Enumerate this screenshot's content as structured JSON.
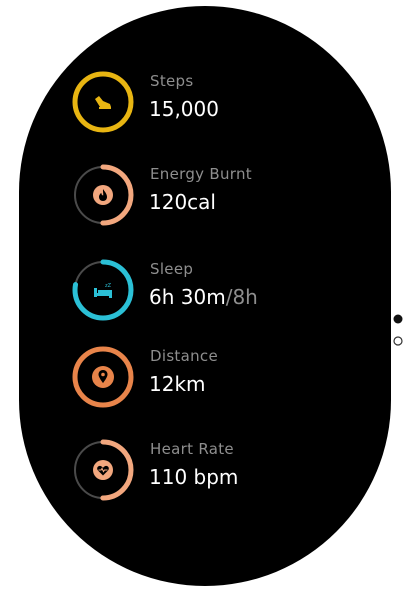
{
  "metrics": [
    {
      "label": "Steps",
      "value": "15,000",
      "goal": "",
      "color": "#E8B512",
      "progress": 1.0,
      "icon": "shoe-icon"
    },
    {
      "label": "Energy Burnt",
      "value": "120cal",
      "goal": "",
      "color": "#F2A77E",
      "progress": 0.5,
      "icon": "flame-icon"
    },
    {
      "label": "Sleep",
      "value": "6h 30m",
      "goal": "/8h",
      "color": "#2BC0D6",
      "progress": 0.78,
      "icon": "bed-icon"
    },
    {
      "label": "Distance",
      "value": "12km",
      "goal": "",
      "color": "#E8844A",
      "progress": 1.0,
      "icon": "location-pin-icon"
    },
    {
      "label": "Heart Rate",
      "value": "110 bpm",
      "goal": "",
      "color": "#F2A77E",
      "progress": 0.5,
      "icon": "heart-pulse-icon"
    }
  ],
  "pager": {
    "pages": 2,
    "active": 0
  }
}
